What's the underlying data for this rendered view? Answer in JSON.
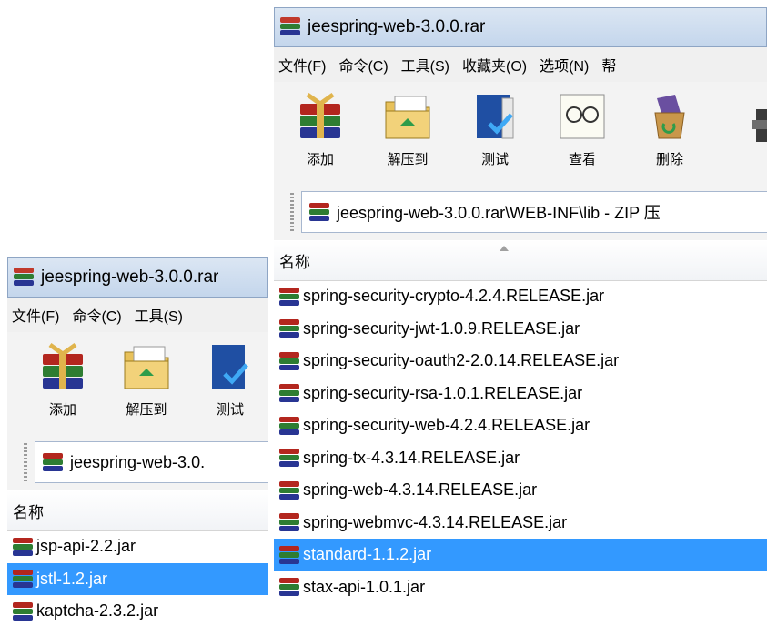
{
  "front": {
    "title": "jeespring-web-3.0.0.rar",
    "menu": [
      "文件(F)",
      "命令(C)",
      "工具(S)",
      "收藏夹(O)",
      "选项(N)",
      "帮"
    ],
    "tools": [
      "添加",
      "解压到",
      "测试",
      "查看",
      "删除"
    ],
    "address": "jeespring-web-3.0.0.rar\\WEB-INF\\lib - ZIP 压",
    "column_name": "名称",
    "files": [
      "spring-security-crypto-4.2.4.RELEASE.jar",
      "spring-security-jwt-1.0.9.RELEASE.jar",
      "spring-security-oauth2-2.0.14.RELEASE.jar",
      "spring-security-rsa-1.0.1.RELEASE.jar",
      "spring-security-web-4.2.4.RELEASE.jar",
      "spring-tx-4.3.14.RELEASE.jar",
      "spring-web-4.3.14.RELEASE.jar",
      "spring-webmvc-4.3.14.RELEASE.jar",
      "standard-1.1.2.jar",
      "stax-api-1.0.1.jar"
    ],
    "selected_file": "standard-1.1.2.jar"
  },
  "back": {
    "title": "jeespring-web-3.0.0.rar",
    "menu": [
      "文件(F)",
      "命令(C)",
      "工具(S)"
    ],
    "tools": [
      "添加",
      "解压到",
      "测试"
    ],
    "address": "jeespring-web-3.0.",
    "column_name": "名称",
    "files": [
      "jsp-api-2.2.jar",
      "jstl-1.2.jar",
      "kaptcha-2.3.2.jar"
    ],
    "selected_file": "jstl-1.2.jar"
  },
  "colors": {
    "selection": "#3399ff",
    "titlebar": "#c4d6ec"
  }
}
